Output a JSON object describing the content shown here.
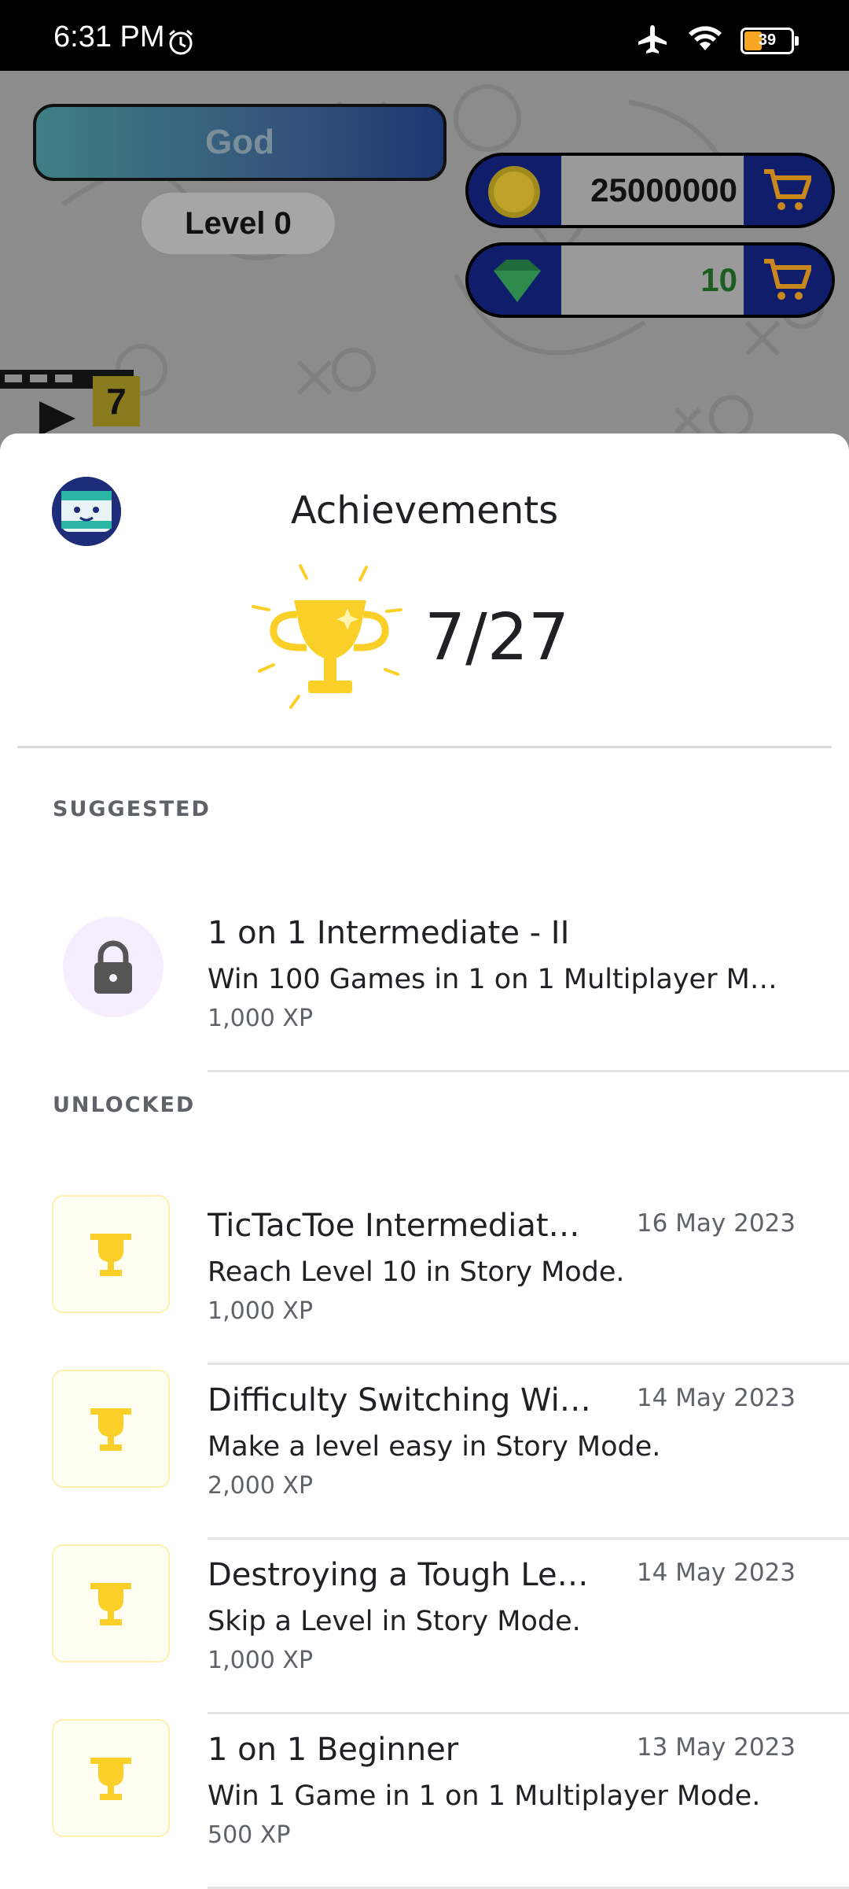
{
  "status_bar": {
    "time": "6:31 PM",
    "battery": "39"
  },
  "game": {
    "rank": "God",
    "level": "Level 0",
    "coins": "25000000",
    "gems": "10",
    "videos_count": "7"
  },
  "sheet": {
    "title": "Achievements",
    "progress": "7/27",
    "suggested_label": "SUGGESTED",
    "unlocked_label": "UNLOCKED",
    "suggested": [
      {
        "title": "1 on 1 Intermediate - II",
        "description": "Win 100 Games in 1 on 1 Multiplayer M…",
        "xp": "1,000 XP"
      }
    ],
    "unlocked": [
      {
        "title": "TicTacToe Intermediat…",
        "description": "Reach Level 10 in Story Mode.",
        "xp": "1,000 XP",
        "date": "16 May 2023"
      },
      {
        "title": "Difficulty Switching Wi…",
        "description": "Make a level easy in Story Mode.",
        "xp": "2,000 XP",
        "date": "14 May 2023"
      },
      {
        "title": "Destroying a Tough Le…",
        "description": "Skip a Level in Story Mode.",
        "xp": "1,000 XP",
        "date": "14 May 2023"
      },
      {
        "title": "1 on 1 Beginner",
        "description": "Win 1 Game in 1 on 1 Multiplayer Mode.",
        "xp": "500 XP",
        "date": "13 May 2023"
      }
    ]
  },
  "colors": {
    "trophy_gold": "#f9cf28",
    "coin_panel": "#0f1d6b",
    "cart": "#f5a623"
  }
}
